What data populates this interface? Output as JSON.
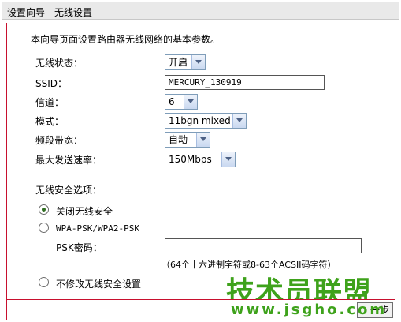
{
  "title": "设置向导 - 无线设置",
  "intro": "本向导页面设置路由器无线网络的基本参数。",
  "fields": {
    "wireless_status": {
      "label": "无线状态：",
      "value": "开启"
    },
    "ssid": {
      "label": "SSID：",
      "value": "MERCURY_130919"
    },
    "channel": {
      "label": "信道：",
      "value": "6"
    },
    "mode": {
      "label": "模式：",
      "value": "11bgn mixed"
    },
    "bandwidth": {
      "label": "频段带宽：",
      "value": "自动"
    },
    "max_rate": {
      "label": "最大发送速率：",
      "value": "150Mbps"
    }
  },
  "security": {
    "heading": "无线安全选项：",
    "options": [
      {
        "label": "关闭无线安全",
        "selected": true
      },
      {
        "label": "WPA-PSK/WPA2-PSK",
        "selected": false
      },
      {
        "label": "不修改无线安全设置",
        "selected": false
      }
    ],
    "psk_label": "PSK密码：",
    "psk_value": "",
    "psk_hint": "（64个十六进制字符或8-63个ACSII码字符）"
  },
  "buttons": {
    "next_visible_text": "一步"
  },
  "watermark": {
    "line1": "技术员联盟",
    "line2": "www.jsgho.com"
  },
  "colors": {
    "accent_border": "#c8102e",
    "watermark": "#3ea21b",
    "radio_dot": "#2f6d21"
  }
}
